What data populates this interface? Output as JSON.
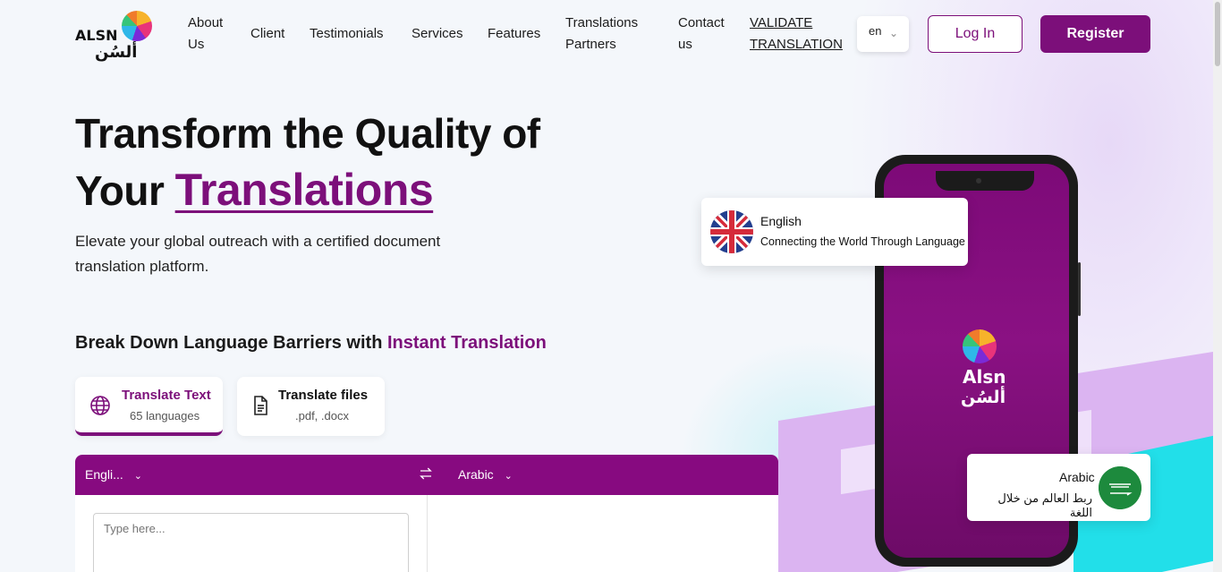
{
  "header": {
    "logo_text": "ALSN",
    "logo_arabic": "ألسُن",
    "nav": {
      "about": "About Us",
      "client": "Client",
      "testimonials": "Testimonials",
      "services": "Services",
      "features": "Features",
      "partners": "Translations Partners",
      "contact": "Contact us",
      "validate": "VALIDATE TRANSLATION"
    },
    "language_selected": "en",
    "login_label": "Log In",
    "register_label": "Register"
  },
  "hero": {
    "title_part1": "Transform the Quality of Your",
    "title_highlight": "Translations",
    "subtitle": "Elevate your global outreach with a certified document translation platform."
  },
  "instant": {
    "title": "Break Down Language Barriers with",
    "title_accent": "Instant Translation"
  },
  "tabs": {
    "text": {
      "title": "Translate Text",
      "sub": "65 languages"
    },
    "files": {
      "title": "Translate files",
      "sub": ".pdf, .docx"
    }
  },
  "translator": {
    "source_lang": "Engli...",
    "target_lang": "Arabic",
    "input_placeholder": "Type here..."
  },
  "phone": {
    "logo_text": "Alsn",
    "logo_arabic": "ألسُن"
  },
  "cards": {
    "english": {
      "language": "English",
      "message": "Connecting the World Through Language"
    },
    "arabic": {
      "language": "Arabic",
      "message": "ربط العالم من خلال اللغة"
    }
  },
  "colors": {
    "brand": "#7c0f7a",
    "translator_bar": "#870a80",
    "accent_cyan": "#22dfe9",
    "accent_lilac": "#dbb4f1"
  }
}
